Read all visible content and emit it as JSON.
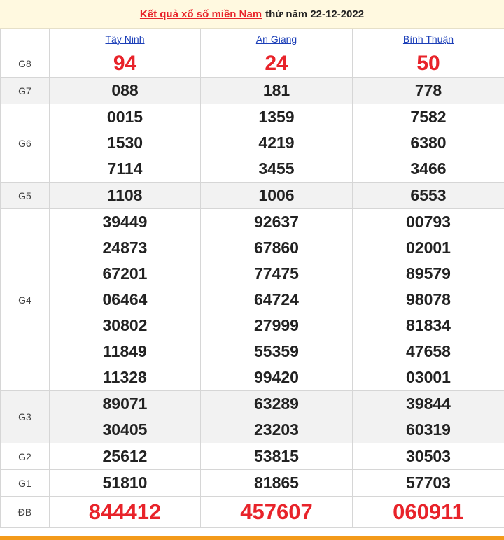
{
  "header": {
    "link_text": "Kết quả xổ số miền Nam",
    "rest_text": "thứ năm 22-12-2022"
  },
  "provinces": [
    "Tây Ninh",
    "An Giang",
    "Bình Thuận"
  ],
  "colors": {
    "accent_red": "#e8232a",
    "link_blue": "#1c3fb8",
    "bottom_bar": "#f39a1a"
  },
  "prizes": {
    "g8": {
      "label": "G8",
      "values": [
        [
          "94"
        ],
        [
          "24"
        ],
        [
          "50"
        ]
      ]
    },
    "g7": {
      "label": "G7",
      "values": [
        [
          "088"
        ],
        [
          "181"
        ],
        [
          "778"
        ]
      ]
    },
    "g6": {
      "label": "G6",
      "values": [
        [
          "0015",
          "1530",
          "7114"
        ],
        [
          "1359",
          "4219",
          "3455"
        ],
        [
          "7582",
          "6380",
          "3466"
        ]
      ]
    },
    "g5": {
      "label": "G5",
      "values": [
        [
          "1108"
        ],
        [
          "1006"
        ],
        [
          "6553"
        ]
      ]
    },
    "g4": {
      "label": "G4",
      "values": [
        [
          "39449",
          "24873",
          "67201",
          "06464",
          "30802",
          "11849",
          "11328"
        ],
        [
          "92637",
          "67860",
          "77475",
          "64724",
          "27999",
          "55359",
          "99420"
        ],
        [
          "00793",
          "02001",
          "89579",
          "98078",
          "81834",
          "47658",
          "03001"
        ]
      ]
    },
    "g3": {
      "label": "G3",
      "values": [
        [
          "89071",
          "30405"
        ],
        [
          "63289",
          "23203"
        ],
        [
          "39844",
          "60319"
        ]
      ]
    },
    "g2": {
      "label": "G2",
      "values": [
        [
          "25612"
        ],
        [
          "53815"
        ],
        [
          "30503"
        ]
      ]
    },
    "g1": {
      "label": "G1",
      "values": [
        [
          "51810"
        ],
        [
          "81865"
        ],
        [
          "57703"
        ]
      ]
    },
    "db": {
      "label": "ĐB",
      "values": [
        [
          "844412"
        ],
        [
          "457607"
        ],
        [
          "060911"
        ]
      ]
    }
  }
}
